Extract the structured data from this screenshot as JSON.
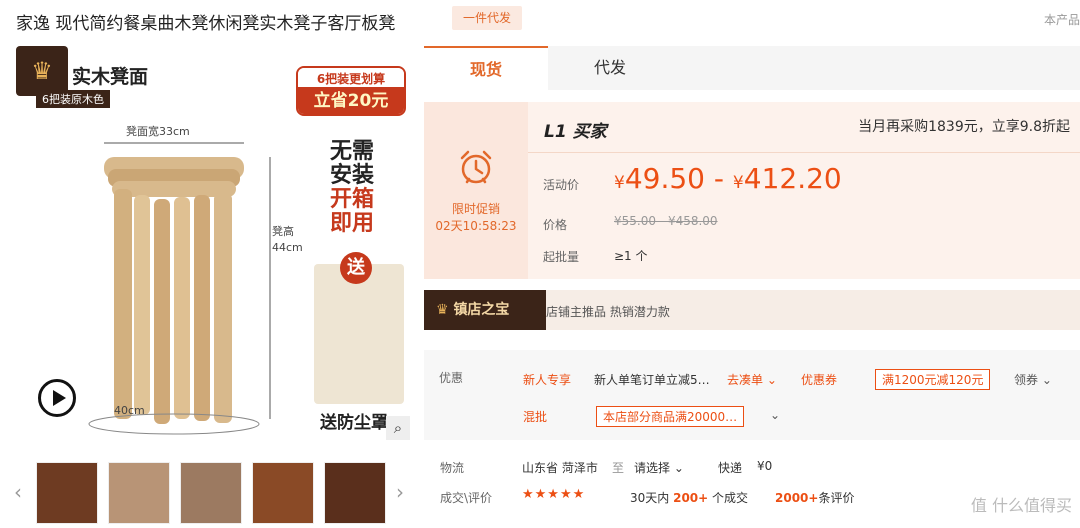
{
  "header": {
    "title": "家逸 现代简约餐桌曲木凳休闲凳实木凳子客厅板凳",
    "dropship_badge": "一件代发",
    "right_text": "本产品"
  },
  "gallery": {
    "img_title": "实木凳面",
    "img_sub": "6把装原木色",
    "promo_top": "6把装更划算",
    "promo_bottom": "立省20元",
    "dim_width": "凳面宽33cm",
    "dim_height": "凳高44cm",
    "dim_base": "40cm",
    "no_setup_line1": "无需安装",
    "no_setup_line2": "开箱即用",
    "gift_tag": "送",
    "gift_label": "送防尘罩"
  },
  "tabs": [
    "现货",
    "代发"
  ],
  "price": {
    "countdown_label": "限时促销",
    "countdown_time": "02天10:58:23",
    "buyer_level": "L1 买家",
    "buyer_offer": "当月再采购1839元，立享9.8折起",
    "activity_label": "活动价",
    "activity_price_low": "49.50",
    "activity_price_high": "412.20",
    "currency": "¥",
    "price_label": "价格",
    "original_price": "¥55.00 - ¥458.00",
    "moq_label": "起批量",
    "moq_value": "≥1 个"
  },
  "shop_bar": {
    "badge": "镇店之宝",
    "text": "店铺主推品  热销潜力款"
  },
  "offers": {
    "label": "优惠",
    "new_user_tag": "新人专享",
    "new_user_text": "新人单笔订单立减5…",
    "bundle_link": "去凑单",
    "coupon_tag": "优惠券",
    "coupon_value": "满1200元减120元",
    "get_coupon": "领券",
    "mixed_tag": "混批",
    "mixed_value": "本店部分商品满20000…"
  },
  "shipping": {
    "label": "物流",
    "origin": "山东省 菏泽市",
    "to": "至",
    "destination": "请选择",
    "method": "快递",
    "fee": "¥0"
  },
  "reviews": {
    "label": "成交\\评价",
    "stars": "★★★★★",
    "sales_prefix": "30天内",
    "sales_count": "200+",
    "sales_suffix": "个成交",
    "review_count": "2000+",
    "review_suffix": "条评价"
  },
  "watermark": "值 什么值得买",
  "colors": {
    "accent": "#e2682a",
    "price": "#ec4f14",
    "brown": "#3b2418"
  }
}
